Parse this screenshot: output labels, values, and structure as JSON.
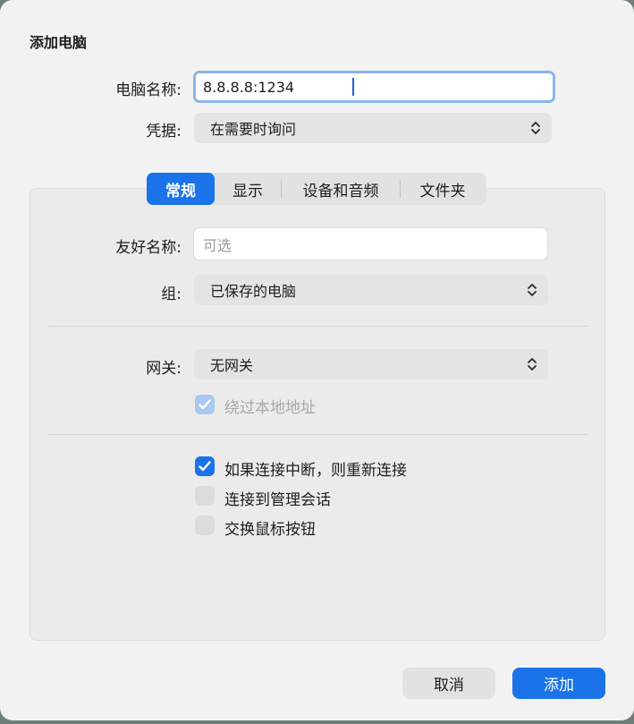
{
  "dialog": {
    "title": "添加电脑"
  },
  "top_form": {
    "pc_name_label": "电脑名称:",
    "pc_name_value": "8.8.8.8:1234",
    "credentials_label": "凭据:",
    "credentials_value": "在需要时询问"
  },
  "tabs": [
    {
      "label": "常规",
      "active": true
    },
    {
      "label": "显示",
      "active": false
    },
    {
      "label": "设备和音频",
      "active": false
    },
    {
      "label": "文件夹",
      "active": false
    }
  ],
  "general": {
    "friendly_name_label": "友好名称:",
    "friendly_name_placeholder": "可选",
    "group_label": "组:",
    "group_value": "已保存的电脑",
    "gateway_label": "网关:",
    "gateway_value": "无网关",
    "bypass_local_label": "绕过本地地址",
    "bypass_local_checked": true,
    "reconnect_label": "如果连接中断，则重新连接",
    "reconnect_checked": true,
    "admin_session_label": "连接到管理会话",
    "admin_session_checked": false,
    "swap_mouse_label": "交换鼠标按钮",
    "swap_mouse_checked": false
  },
  "buttons": {
    "cancel": "取消",
    "add": "添加"
  },
  "colors": {
    "accent": "#1a73e8",
    "focus_ring": "#8ab4e8"
  }
}
